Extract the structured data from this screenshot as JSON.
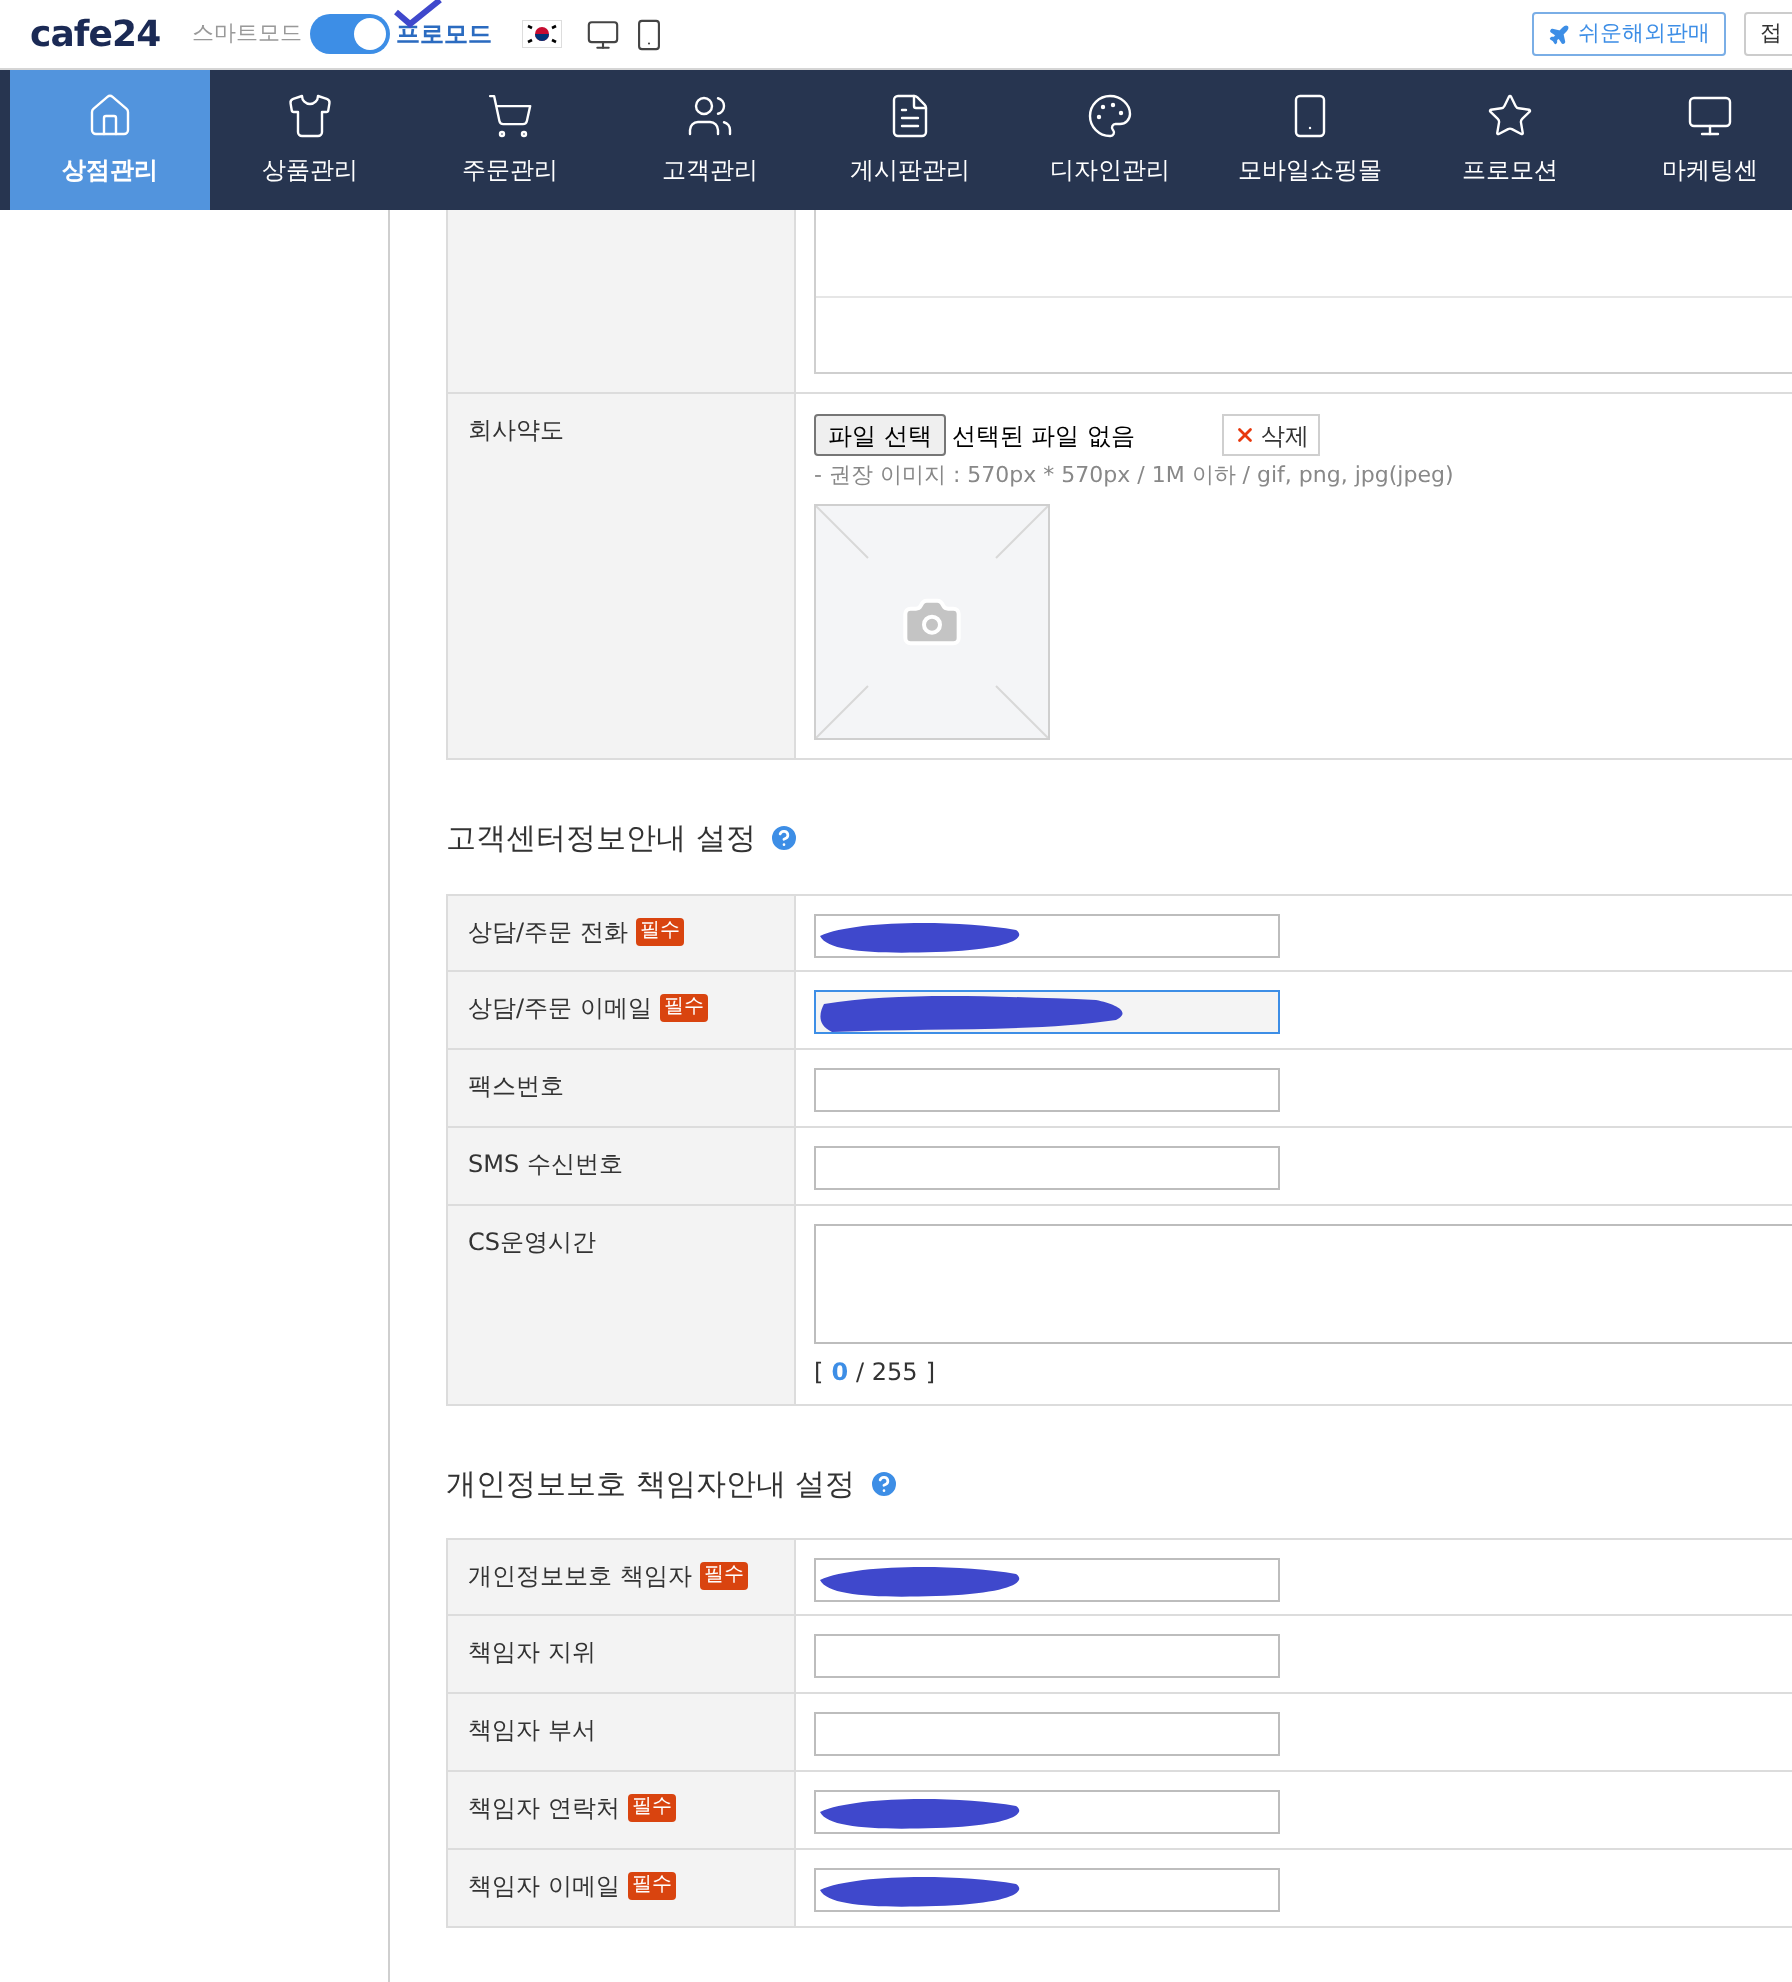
{
  "topbar": {
    "logo": "cafe24",
    "mode_off_label": "스마트모드",
    "mode_on_label": "프로모드",
    "toggle_on": true,
    "overseas_button": "쉬운해외판매",
    "connect_button": "접"
  },
  "nav": [
    {
      "label": "상점관리",
      "selected": true
    },
    {
      "label": "상품관리",
      "selected": false
    },
    {
      "label": "주문관리",
      "selected": false
    },
    {
      "label": "고객관리",
      "selected": false
    },
    {
      "label": "게시판관리",
      "selected": false
    },
    {
      "label": "디자인관리",
      "selected": false
    },
    {
      "label": "모바일쇼핑몰",
      "selected": false
    },
    {
      "label": "프로모션",
      "selected": false
    },
    {
      "label": "마케팅센",
      "selected": false
    }
  ],
  "top_table": {
    "rows": [
      {
        "kind": "memo"
      },
      {
        "kind": "file",
        "label": "회사약도",
        "file_button": "파일 선택",
        "file_status": "선택된 파일 없음",
        "delete_button": "삭제",
        "hint": "- 권장 이미지 : 570px * 570px / 1M 이하 / gif, png, jpg(jpeg)"
      }
    ]
  },
  "sections": [
    {
      "title": "고객센터정보안내 설정",
      "rows": [
        {
          "kind": "input",
          "label": "상담/주문 전화",
          "badge": "필수",
          "redacted": true,
          "focused": false
        },
        {
          "kind": "input",
          "label": "상담/주문 이메일",
          "badge": "필수",
          "redacted": true,
          "focused": true
        },
        {
          "kind": "input",
          "label": "팩스번호",
          "redacted": false,
          "focused": false
        },
        {
          "kind": "input",
          "label": "SMS 수신번호",
          "redacted": false,
          "focused": false
        },
        {
          "kind": "textarea",
          "label": "CS운영시간",
          "counter": {
            "open": "[",
            "current": "0",
            "total": "/ 255",
            "close": "]"
          }
        }
      ]
    },
    {
      "title": "개인정보보호 책임자안내 설정",
      "rows": [
        {
          "kind": "input",
          "label": "개인정보보호 책임자",
          "badge": "필수",
          "redacted": true,
          "focused": false
        },
        {
          "kind": "input",
          "label": "책임자 지위",
          "redacted": false,
          "focused": false
        },
        {
          "kind": "input",
          "label": "책임자 부서",
          "redacted": false,
          "focused": false
        },
        {
          "kind": "input",
          "label": "책임자 연락처",
          "badge": "필수",
          "redacted": true,
          "focused": false
        },
        {
          "kind": "input",
          "label": "책임자 이메일",
          "badge": "필수",
          "redacted": true,
          "focused": false
        }
      ]
    }
  ]
}
